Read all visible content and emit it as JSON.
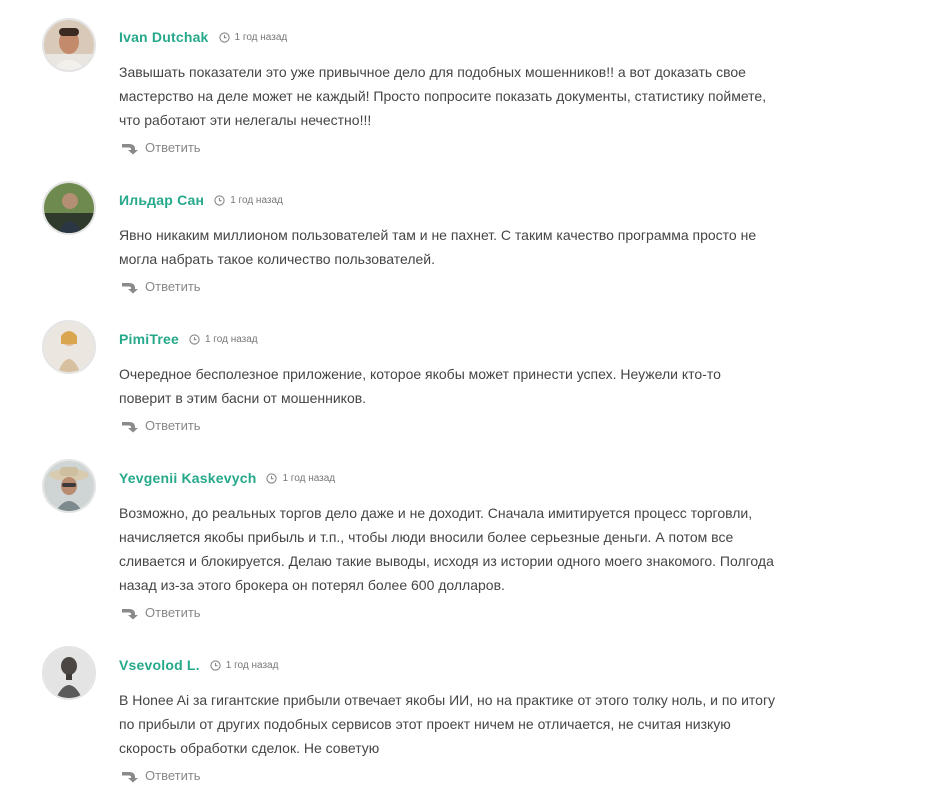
{
  "reply_label": "Ответить",
  "colors": {
    "author": "#26a88a",
    "text": "#454545",
    "muted": "#888888"
  },
  "comments": [
    {
      "author": "Ivan Dutchak",
      "date": "1 год назад",
      "lines": [
        "Завышать показатели это уже привычное дело для подобных мошенников!! а вот доказать свое",
        "мастерство на деле может не каждый! Просто попросите показать документы, статистику поймете,",
        "что работают эти нелегалы нечестно!!!"
      ],
      "avatar_icon": "user-photo"
    },
    {
      "author": "Ильдар Сан",
      "date": "1 год назад",
      "lines": [
        "Явно никаким миллионом пользователей там и не пахнет. С таким качество программа просто не",
        "могла набрать такое количество пользователей."
      ],
      "avatar_icon": "user-photo"
    },
    {
      "author": "PimiTree",
      "date": "1 год назад",
      "lines": [
        "Очередное бесполезное приложение, которое якобы может принести успех. Неужели кто-то",
        "поверит в этим басни от мошенников."
      ],
      "avatar_icon": "user-photo"
    },
    {
      "author": "Yevgenii Kaskevych",
      "date": "1 год назад",
      "lines": [
        "Возможно, до реальных торгов дело даже и не доходит. Сначала имитируется процесс торговли,",
        "начисляется якобы прибыль и т.п., чтобы люди вносили более серьезные деньги. А потом все",
        "сливается и блокируется. Делаю такие выводы, исходя из истории одного моего знакомого. Полгода",
        "назад из-за этого брокера он потерял более 600 долларов."
      ],
      "avatar_icon": "user-photo"
    },
    {
      "author": "Vsevolod L.",
      "date": "1 год назад",
      "lines": [
        "В Honee Ai за гигантские прибыли отвечает якобы ИИ, но на практике от этого толку ноль, и по итогу",
        "по прибыли от других подобных сервисов этот проект ничем не отличается, не считая низкую",
        "скорость обработки сделок. Не советую"
      ],
      "avatar_icon": "user-photo"
    }
  ]
}
